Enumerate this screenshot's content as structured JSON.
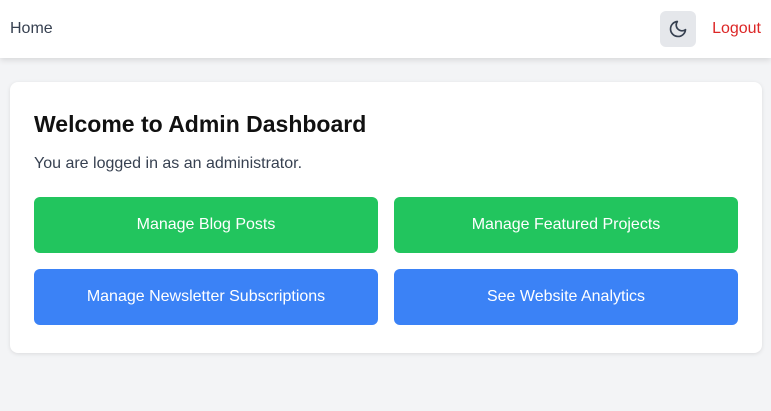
{
  "header": {
    "home_label": "Home",
    "theme_toggle_icon": "moon-icon",
    "logout_label": "Logout"
  },
  "colors": {
    "background": "#f3f4f6",
    "green_button": "#22c55e",
    "blue_button": "#3b82f6",
    "logout_text": "#dc2626",
    "toggle_bg": "#e5e7eb"
  },
  "dashboard": {
    "title": "Welcome to Admin Dashboard",
    "subtitle": "You are logged in as an administrator.",
    "buttons": [
      {
        "label": "Manage Blog Posts",
        "color": "green"
      },
      {
        "label": "Manage Featured Projects",
        "color": "green"
      },
      {
        "label": "Manage Newsletter Subscriptions",
        "color": "blue"
      },
      {
        "label": "See Website Analytics",
        "color": "blue"
      }
    ]
  }
}
